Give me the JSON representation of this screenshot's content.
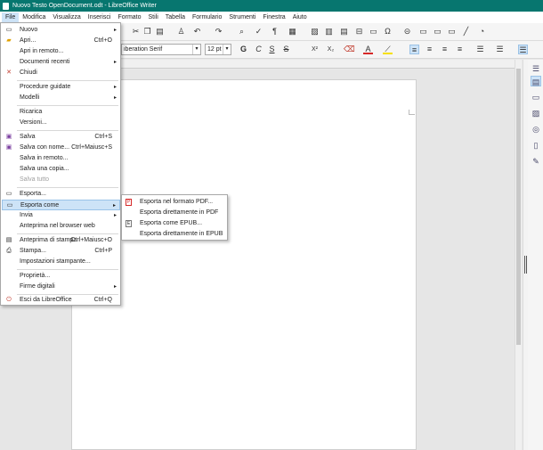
{
  "window": {
    "title": "Nuovo Testo OpenDocument.odt - LibreOffice Writer"
  },
  "menubar": [
    "File",
    "Modifica",
    "Visualizza",
    "Inserisci",
    "Formato",
    "Stili",
    "Tabella",
    "Formulario",
    "Strumenti",
    "Finestra",
    "Aiuto"
  ],
  "toolbar": {
    "font_name": "iberation Serif",
    "font_size": "12 pt",
    "bold": "G",
    "italic": "C",
    "underline": "S",
    "strike": "S",
    "superscript": "X²",
    "subscript": "X₂",
    "font_color": "A",
    "highlight": "⟋"
  },
  "file_menu": [
    {
      "label": "Nuovo",
      "shortcut": "",
      "submenu": true,
      "icon": "new-doc-icon",
      "glyph": "▭"
    },
    {
      "label": "Apri...",
      "shortcut": "Ctrl+O",
      "submenu": false,
      "icon": "folder-open-icon",
      "glyph": "▰"
    },
    {
      "label": "Apri in remoto...",
      "shortcut": "",
      "submenu": false,
      "icon": "",
      "glyph": ""
    },
    {
      "label": "Documenti recenti",
      "shortcut": "",
      "submenu": true,
      "icon": "",
      "glyph": ""
    },
    {
      "label": "Chiudi",
      "shortcut": "",
      "submenu": false,
      "icon": "close-doc-icon",
      "glyph": "✕"
    },
    {
      "label": "Procedure guidate",
      "shortcut": "",
      "submenu": true,
      "icon": "",
      "glyph": ""
    },
    {
      "label": "Modelli",
      "shortcut": "",
      "submenu": true,
      "icon": "",
      "glyph": ""
    },
    {
      "label": "Ricarica",
      "shortcut": "",
      "submenu": false,
      "icon": "",
      "glyph": ""
    },
    {
      "label": "Versioni...",
      "shortcut": "",
      "submenu": false,
      "icon": "",
      "glyph": ""
    },
    {
      "label": "Salva",
      "shortcut": "Ctrl+S",
      "submenu": false,
      "icon": "save-icon",
      "glyph": "▣"
    },
    {
      "label": "Salva con nome...",
      "shortcut": "Ctrl+Maiusc+S",
      "submenu": false,
      "icon": "save-as-icon",
      "glyph": "▣"
    },
    {
      "label": "Salva in remoto...",
      "shortcut": "",
      "submenu": false,
      "icon": "",
      "glyph": ""
    },
    {
      "label": "Salva una copia...",
      "shortcut": "",
      "submenu": false,
      "icon": "",
      "glyph": ""
    },
    {
      "label": "Salva tutto",
      "shortcut": "",
      "submenu": false,
      "icon": "",
      "glyph": "",
      "disabled": true
    },
    {
      "label": "Esporta...",
      "shortcut": "",
      "submenu": false,
      "icon": "export-icon",
      "glyph": "▭"
    },
    {
      "label": "Esporta come",
      "shortcut": "",
      "submenu": true,
      "icon": "export-as-icon",
      "glyph": "▭",
      "hover": true
    },
    {
      "label": "Invia",
      "shortcut": "",
      "submenu": true,
      "icon": "",
      "glyph": ""
    },
    {
      "label": "Anteprima nel browser web",
      "shortcut": "",
      "submenu": false,
      "icon": "",
      "glyph": ""
    },
    {
      "label": "Anteprima di stampa",
      "shortcut": "Ctrl+Maiusc+O",
      "submenu": false,
      "icon": "print-preview-icon",
      "glyph": "▤"
    },
    {
      "label": "Stampa...",
      "shortcut": "Ctrl+P",
      "submenu": false,
      "icon": "printer-icon",
      "glyph": "⎙"
    },
    {
      "label": "Impostazioni stampante...",
      "shortcut": "",
      "submenu": false,
      "icon": "",
      "glyph": ""
    },
    {
      "label": "Proprietà...",
      "shortcut": "",
      "submenu": false,
      "icon": "",
      "glyph": ""
    },
    {
      "label": "Firme digitali",
      "shortcut": "",
      "submenu": true,
      "icon": "",
      "glyph": ""
    },
    {
      "label": "Esci da LibreOffice",
      "shortcut": "Ctrl+Q",
      "submenu": false,
      "icon": "exit-icon",
      "glyph": "⏻"
    }
  ],
  "export_submenu": [
    {
      "label": "Esporta nel formato PDF...",
      "icon": "pdf-icon",
      "glyph": "P"
    },
    {
      "label": "Esporta direttamente in PDF",
      "icon": "",
      "glyph": ""
    },
    {
      "label": "Esporta come EPUB...",
      "icon": "epub-icon",
      "glyph": "E"
    },
    {
      "label": "Esporta direttamente in EPUB",
      "icon": "",
      "glyph": ""
    }
  ],
  "colors": {
    "titlebar": "#07766f",
    "menu_hover": "#cde3f7",
    "font_color_bar": "#d62828",
    "highlight_bar": "#f6e000"
  }
}
